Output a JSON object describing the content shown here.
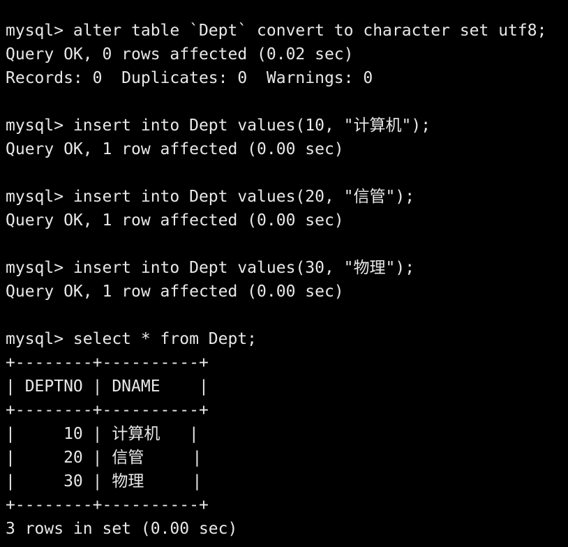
{
  "lines": [
    "mysql> alter table `Dept` convert to character set utf8;",
    "Query OK, 0 rows affected (0.02 sec)",
    "Records: 0  Duplicates: 0  Warnings: 0",
    "",
    "mysql> insert into Dept values(10, \"计算机\");",
    "Query OK, 1 row affected (0.00 sec)",
    "",
    "mysql> insert into Dept values(20, \"信管\");",
    "Query OK, 1 row affected (0.00 sec)",
    "",
    "mysql> insert into Dept values(30, \"物理\");",
    "Query OK, 1 row affected (0.00 sec)",
    "",
    "mysql> select * from Dept;",
    "+--------+----------+",
    "| DEPTNO | DNAME    |",
    "+--------+----------+",
    "|     10 | 计算机   |",
    "|     20 | 信管     |",
    "|     30 | 物理     |",
    "+--------+----------+",
    "3 rows in set (0.00 sec)"
  ]
}
